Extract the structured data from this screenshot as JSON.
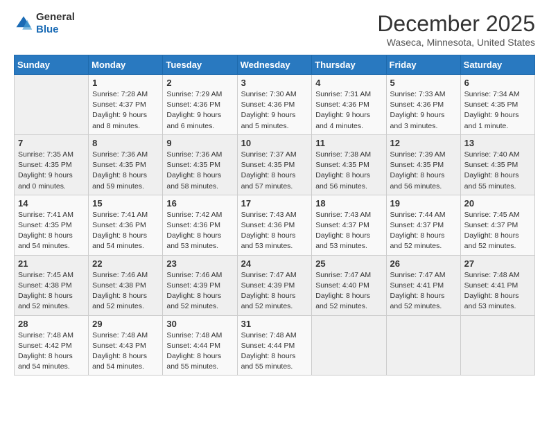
{
  "logo": {
    "general": "General",
    "blue": "Blue"
  },
  "header": {
    "month": "December 2025",
    "location": "Waseca, Minnesota, United States"
  },
  "weekdays": [
    "Sunday",
    "Monday",
    "Tuesday",
    "Wednesday",
    "Thursday",
    "Friday",
    "Saturday"
  ],
  "weeks": [
    [
      {
        "day": "",
        "info": ""
      },
      {
        "day": "1",
        "info": "Sunrise: 7:28 AM\nSunset: 4:37 PM\nDaylight: 9 hours\nand 8 minutes."
      },
      {
        "day": "2",
        "info": "Sunrise: 7:29 AM\nSunset: 4:36 PM\nDaylight: 9 hours\nand 6 minutes."
      },
      {
        "day": "3",
        "info": "Sunrise: 7:30 AM\nSunset: 4:36 PM\nDaylight: 9 hours\nand 5 minutes."
      },
      {
        "day": "4",
        "info": "Sunrise: 7:31 AM\nSunset: 4:36 PM\nDaylight: 9 hours\nand 4 minutes."
      },
      {
        "day": "5",
        "info": "Sunrise: 7:33 AM\nSunset: 4:36 PM\nDaylight: 9 hours\nand 3 minutes."
      },
      {
        "day": "6",
        "info": "Sunrise: 7:34 AM\nSunset: 4:35 PM\nDaylight: 9 hours\nand 1 minute."
      }
    ],
    [
      {
        "day": "7",
        "info": "Sunrise: 7:35 AM\nSunset: 4:35 PM\nDaylight: 9 hours\nand 0 minutes."
      },
      {
        "day": "8",
        "info": "Sunrise: 7:36 AM\nSunset: 4:35 PM\nDaylight: 8 hours\nand 59 minutes."
      },
      {
        "day": "9",
        "info": "Sunrise: 7:36 AM\nSunset: 4:35 PM\nDaylight: 8 hours\nand 58 minutes."
      },
      {
        "day": "10",
        "info": "Sunrise: 7:37 AM\nSunset: 4:35 PM\nDaylight: 8 hours\nand 57 minutes."
      },
      {
        "day": "11",
        "info": "Sunrise: 7:38 AM\nSunset: 4:35 PM\nDaylight: 8 hours\nand 56 minutes."
      },
      {
        "day": "12",
        "info": "Sunrise: 7:39 AM\nSunset: 4:35 PM\nDaylight: 8 hours\nand 56 minutes."
      },
      {
        "day": "13",
        "info": "Sunrise: 7:40 AM\nSunset: 4:35 PM\nDaylight: 8 hours\nand 55 minutes."
      }
    ],
    [
      {
        "day": "14",
        "info": "Sunrise: 7:41 AM\nSunset: 4:35 PM\nDaylight: 8 hours\nand 54 minutes."
      },
      {
        "day": "15",
        "info": "Sunrise: 7:41 AM\nSunset: 4:36 PM\nDaylight: 8 hours\nand 54 minutes."
      },
      {
        "day": "16",
        "info": "Sunrise: 7:42 AM\nSunset: 4:36 PM\nDaylight: 8 hours\nand 53 minutes."
      },
      {
        "day": "17",
        "info": "Sunrise: 7:43 AM\nSunset: 4:36 PM\nDaylight: 8 hours\nand 53 minutes."
      },
      {
        "day": "18",
        "info": "Sunrise: 7:43 AM\nSunset: 4:37 PM\nDaylight: 8 hours\nand 53 minutes."
      },
      {
        "day": "19",
        "info": "Sunrise: 7:44 AM\nSunset: 4:37 PM\nDaylight: 8 hours\nand 52 minutes."
      },
      {
        "day": "20",
        "info": "Sunrise: 7:45 AM\nSunset: 4:37 PM\nDaylight: 8 hours\nand 52 minutes."
      }
    ],
    [
      {
        "day": "21",
        "info": "Sunrise: 7:45 AM\nSunset: 4:38 PM\nDaylight: 8 hours\nand 52 minutes."
      },
      {
        "day": "22",
        "info": "Sunrise: 7:46 AM\nSunset: 4:38 PM\nDaylight: 8 hours\nand 52 minutes."
      },
      {
        "day": "23",
        "info": "Sunrise: 7:46 AM\nSunset: 4:39 PM\nDaylight: 8 hours\nand 52 minutes."
      },
      {
        "day": "24",
        "info": "Sunrise: 7:47 AM\nSunset: 4:39 PM\nDaylight: 8 hours\nand 52 minutes."
      },
      {
        "day": "25",
        "info": "Sunrise: 7:47 AM\nSunset: 4:40 PM\nDaylight: 8 hours\nand 52 minutes."
      },
      {
        "day": "26",
        "info": "Sunrise: 7:47 AM\nSunset: 4:41 PM\nDaylight: 8 hours\nand 52 minutes."
      },
      {
        "day": "27",
        "info": "Sunrise: 7:48 AM\nSunset: 4:41 PM\nDaylight: 8 hours\nand 53 minutes."
      }
    ],
    [
      {
        "day": "28",
        "info": "Sunrise: 7:48 AM\nSunset: 4:42 PM\nDaylight: 8 hours\nand 54 minutes."
      },
      {
        "day": "29",
        "info": "Sunrise: 7:48 AM\nSunset: 4:43 PM\nDaylight: 8 hours\nand 54 minutes."
      },
      {
        "day": "30",
        "info": "Sunrise: 7:48 AM\nSunset: 4:44 PM\nDaylight: 8 hours\nand 55 minutes."
      },
      {
        "day": "31",
        "info": "Sunrise: 7:48 AM\nSunset: 4:44 PM\nDaylight: 8 hours\nand 55 minutes."
      },
      {
        "day": "",
        "info": ""
      },
      {
        "day": "",
        "info": ""
      },
      {
        "day": "",
        "info": ""
      }
    ]
  ]
}
